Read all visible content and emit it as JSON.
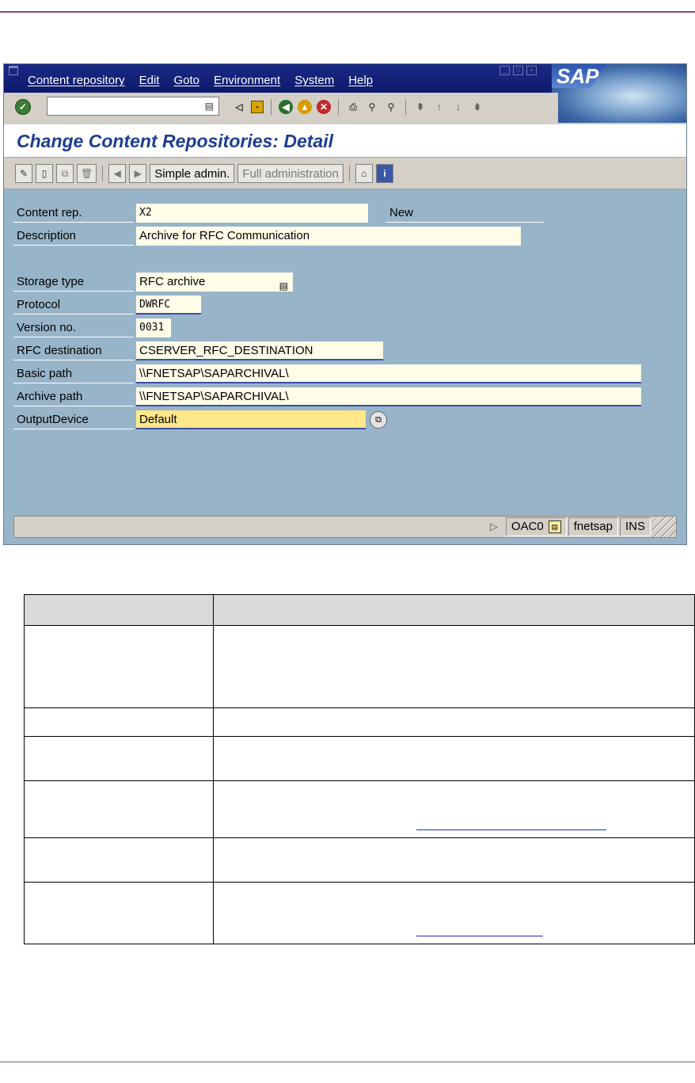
{
  "window": {
    "menu": [
      "Content repository",
      "Edit",
      "Goto",
      "Environment",
      "System",
      "Help"
    ],
    "logo": "SAP",
    "title": "Change Content Repositories: Detail"
  },
  "toolbar2": {
    "simple_admin": "Simple admin.",
    "full_admin": "Full administration"
  },
  "form": {
    "content_rep": {
      "label": "Content rep.",
      "value": "X2",
      "status": "New"
    },
    "description": {
      "label": "Description",
      "value": "Archive for RFC  Communication"
    },
    "storage_type": {
      "label": "Storage type",
      "value": "RFC archive"
    },
    "protocol": {
      "label": "Protocol",
      "value": "DWRFC"
    },
    "version_no": {
      "label": "Version no.",
      "value": "0031"
    },
    "rfc_destination": {
      "label": "RFC destination",
      "value": "CSERVER_RFC_DESTINATION"
    },
    "basic_path": {
      "label": "Basic path",
      "value": "\\\\FNETSAP\\SAPARCHIVAL\\"
    },
    "archive_path": {
      "label": "Archive path",
      "value": "\\\\FNETSAP\\SAPARCHIVAL\\"
    },
    "output_device": {
      "label": "OutputDevice",
      "value": "Default"
    }
  },
  "statusbar": {
    "transaction": "OAC0",
    "server": "fnetsap",
    "mode": "INS"
  },
  "colors": {
    "menubar": "#1b2a85",
    "screen_bg": "#98b4c8",
    "title_text": "#1c3d8f",
    "field_bg": "#fffce8",
    "focus_field_bg": "#ffe88a"
  }
}
